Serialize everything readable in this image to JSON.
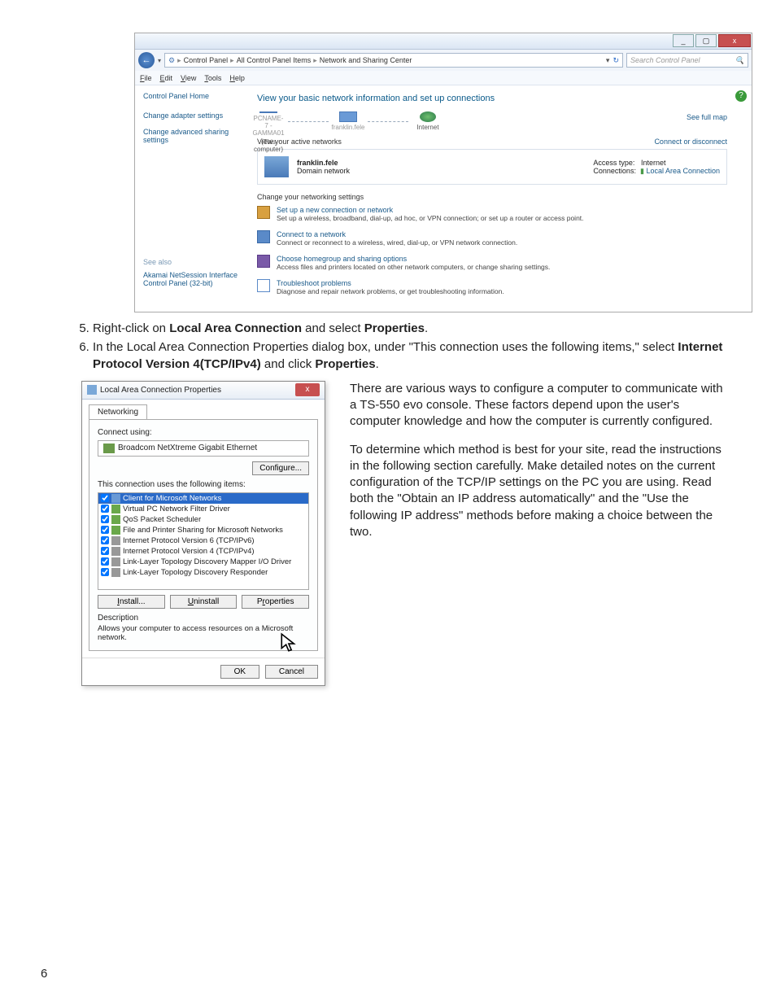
{
  "window1": {
    "titlebar": {
      "min": "_",
      "max": "▢",
      "close": "x"
    },
    "nav": {
      "back": "←",
      "fwd_dropdown": "▾",
      "icon_label": "⚙",
      "crumb1": "Control Panel",
      "crumb2": "All Control Panel Items",
      "crumb3": "Network and Sharing Center",
      "dropdown": "▾",
      "refresh": "↻",
      "search_placeholder": "Search Control Panel",
      "search_icon": "🔍"
    },
    "menu": {
      "file": "File",
      "edit": "Edit",
      "view": "View",
      "tools": "Tools",
      "help": "Help"
    },
    "sidebar": {
      "home": "Control Panel Home",
      "link1": "Change adapter settings",
      "link2": "Change advanced sharing settings",
      "seealso": "See also",
      "see1": "Akamai NetSession Interface Control Panel (32-bit)"
    },
    "main": {
      "heading": "View your basic network information and set up connections",
      "help_icon": "?",
      "fullmap": "See full map",
      "node1_sub": "(This computer)",
      "node1_name": "PCNAME-7 - GAMMA01",
      "node2_name": "franklin.fele",
      "node3": "Internet",
      "active_label": "View your active networks",
      "conn_disc": "Connect or disconnect",
      "active_name": "franklin.fele",
      "active_type": "Domain network",
      "access_label": "Access type:",
      "access_val": "Internet",
      "conn_label": "Connections:",
      "conn_val": "Local Area Connection",
      "change_label": "Change your networking settings",
      "s1_title": "Set up a new connection or network",
      "s1_desc": "Set up a wireless, broadband, dial-up, ad hoc, or VPN connection; or set up a router or access point.",
      "s2_title": "Connect to a network",
      "s2_desc": "Connect or reconnect to a wireless, wired, dial-up, or VPN network connection.",
      "s3_title": "Choose homegroup and sharing options",
      "s3_desc": "Access files and printers located on other network computers, or change sharing settings.",
      "s4_title": "Troubleshoot problems",
      "s4_desc": "Diagnose and repair network problems, or get troubleshooting information."
    }
  },
  "instr": {
    "li5a": "Right-click on ",
    "li5b": "Local Area Connection",
    "li5c": " and select ",
    "li5d": "Properties",
    "li5e": ".",
    "li6a": "In the Local Area Connection Properties dialog box, under \"This connection uses the following items,\" select ",
    "li6b": "Internet Protocol Version 4(TCP/IPv4)",
    "li6c": " and click ",
    "li6d": "Properties",
    "li6e": "."
  },
  "dialog": {
    "title": "Local Area Connection Properties",
    "close": "x",
    "tab": "Networking",
    "connect_using": "Connect using:",
    "adapter": "Broadcom NetXtreme Gigabit Ethernet",
    "configure": "Configure...",
    "items_label": "This connection uses the following items:",
    "items": [
      "Client for Microsoft Networks",
      "Virtual PC Network Filter Driver",
      "QoS Packet Scheduler",
      "File and Printer Sharing for Microsoft Networks",
      "Internet Protocol Version 6 (TCP/IPv6)",
      "Internet Protocol Version 4 (TCP/IPv4)",
      "Link-Layer Topology Discovery Mapper I/O Driver",
      "Link-Layer Topology Discovery Responder"
    ],
    "install": "Install...",
    "uninstall": "Uninstall",
    "properties": "Properties",
    "desc_label": "Description",
    "desc_text": "Allows your computer to access resources on a Microsoft network.",
    "ok": "OK",
    "cancel": "Cancel"
  },
  "para1": "There are various ways to configure a computer to communicate with a TS-550 evo console. These factors depend upon the user's computer knowledge and how the computer is currently configured.",
  "para2": "To determine which method is best for your site, read the instructions in the following section carefully. Make detailed notes on the current configuration of the TCP/IP settings on the PC you are using. Read both the \"Obtain an IP address automatically\" and the \"Use the following IP address\" methods before making a choice between the two.",
  "pagenum": "6"
}
